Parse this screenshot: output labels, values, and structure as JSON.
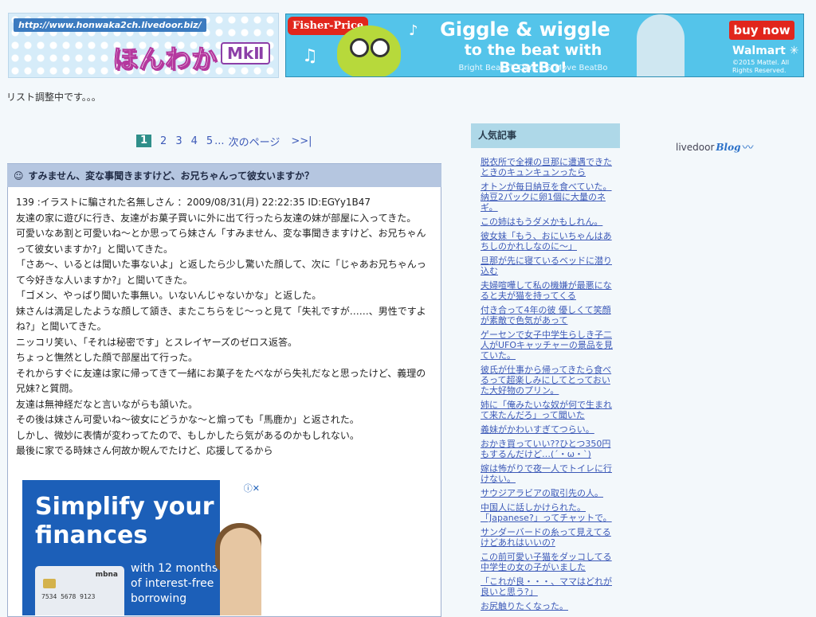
{
  "header": {
    "logo_url_text": "http://www.honwaka2ch.livedoor.biz/",
    "logo_title": "ほんわか",
    "logo_mk": "MkⅡ",
    "status_text": "リスト調整中です。。。"
  },
  "banner_ad": {
    "brand": "Fisher-Price",
    "headline": "Giggle & wiggle",
    "subline": "to the beat with BeatBo!",
    "fine_print": "Bright Beats™ Dance & Move BeatBo",
    "cta": "buy now",
    "retailer": "Walmart ✳",
    "copyright": "©2015 Mattel. All Rights Reserved."
  },
  "pagination": {
    "pages": [
      "1",
      "2",
      "3",
      "4",
      "5"
    ],
    "current": "1",
    "ellipsis": "...",
    "next_label": "次のページ",
    "last_label": ">>|"
  },
  "article": {
    "icon": "☺",
    "title": "すみません、変な事聞きますけど、お兄ちゃんって彼女いますか？",
    "lines": [
      "139 :イラストに騙された名無しさん ：2009/08/31(月) 22:22:35 ID:EGYy1B47",
      "友達の家に遊びに行き、友達がお菓子買いに外に出て行ったら友達の妹が部屋に入ってきた。",
      "可愛いなあ割と可愛いね〜とか思ってら妹さん「すみません、変な事聞きますけど、お兄ちゃんって彼女いますか?」と聞いてきた。",
      "「さあ〜、いるとは聞いた事ないよ」と返したら少し驚いた顔して、次に「じゃあお兄ちゃんって今好きな人いますか?」と聞いてきた。",
      "「ゴメン、やっぱり聞いた事無い。いないんじゃないかな」と返した。",
      "妹さんは満足したような顔して頷き、またこちらをじ〜っと見て「失礼ですが……、男性ですよね?」と聞いてきた。",
      "ニッコリ笑い、「それは秘密です」とスレイヤーズのゼロス返答。",
      "ちょっと憮然とした顔で部屋出て行った。",
      "それからすぐに友達は家に帰ってきて一緒にお菓子をたべながら失礼だなと思ったけど、義理の兄妹?と質問。",
      "友達は無神経だなと言いながらも頷いた。",
      "その後は妹さん可愛いね〜彼女にどうかな〜と煽っても「馬鹿か」と返された。",
      "しかし、微妙に表情が変わってたので、もしかしたら気があるのかもしれない。",
      "最後に家でる時妹さん何故か睨んでたけど、応援してるから"
    ]
  },
  "inline_ad": {
    "headline": "Simplify your finances",
    "body": "with 12 months of interest-free borrowing",
    "card_brand": "mbna",
    "card_number": "7534 5678 9123",
    "choice_icon": "ⓘ✕"
  },
  "sidebar": {
    "title": "人気記事",
    "items": [
      "脱衣所で全裸の旦那に遭遇できたときのキュンキュンったら",
      "オトンが毎日納豆を食べていた。納豆2パックに卵1個に大量のネギ。",
      "この姉はもうダメかもしれん。",
      "彼女妹「もう、おにいちゃんはあちしのかれしなのに〜」",
      "旦那が先に寝ているベッドに潜り込む",
      "夫婦喧嘩して私の機嫌が最悪になると夫が猫を持ってくる",
      "付き合って4年の彼 優しくて笑顔が素敵で色気があって",
      "ゲーセンで女子中学生らしき子二人がUFOキャッチャーの景品を見ていた。",
      "彼氏が仕事から帰ってきたら食べるって超楽しみにしてとっておいた大好物のプリン。",
      "姉に「俺みたいな奴が何で生まれて来たんだろ」って聞いた",
      "義妹がかわいすぎてつらい。",
      "おかき買っていい??ひとつ350円もするんだけど…(´・ω・`)",
      "嫁は怖がりで夜一人でトイレに行けない。",
      "サウジアラビアの取引先の人。",
      "中国人に話しかけられた。「Japanese?」ってチャットで。",
      "サンダーバードの糸って見えてるけどあれはいいの?",
      "この前可愛い子猫をダッコしてる中学生の女の子がいました",
      "「これが良・・・、ママはどれが良いと思う?」",
      "お尻触りたくなった。"
    ]
  },
  "livedoor": {
    "text": "livedoor",
    "blog": "Blog"
  },
  "colors": {
    "page_bg": "#f3f8fb",
    "link": "#3d5ab8",
    "current_page": "#2f8f8a",
    "article_header": "#b5c6e0",
    "sidebar_header": "#aed8e8"
  }
}
